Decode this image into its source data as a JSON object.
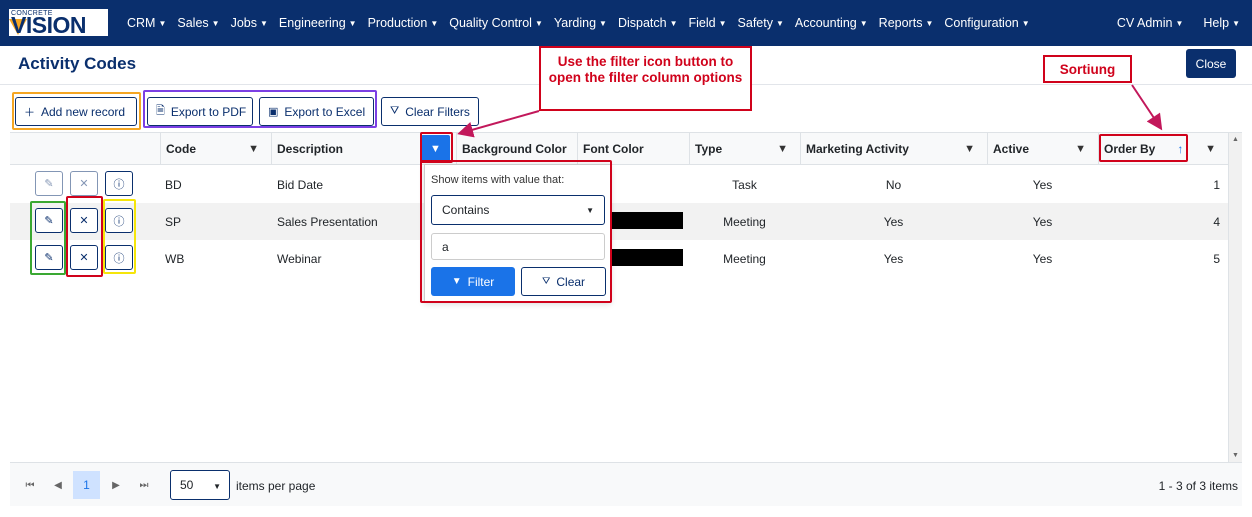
{
  "app": {
    "logo_top": "CONCRETE",
    "logo_main": "VISION",
    "menu": [
      "CRM",
      "Sales",
      "Jobs",
      "Engineering",
      "Production",
      "Quality Control",
      "Yarding",
      "Dispatch",
      "Field",
      "Safety",
      "Accounting",
      "Reports",
      "Configuration"
    ],
    "user_menu": "CV Admin",
    "help_menu": "Help"
  },
  "page": {
    "title": "Activity Codes",
    "close_label": "Close"
  },
  "toolbar": {
    "add_label": "Add new record",
    "export_pdf_label": "Export to PDF",
    "export_excel_label": "Export to Excel",
    "clear_filters_label": "Clear Filters"
  },
  "grid": {
    "columns": [
      "Code",
      "Description",
      "Background Color",
      "Font Color",
      "Type",
      "Marketing Activity",
      "Active",
      "Order By"
    ],
    "rows": [
      {
        "code": "BD",
        "description": "Bid Date",
        "type": "Task",
        "marketing": "No",
        "active": "Yes",
        "order": "1"
      },
      {
        "code": "SP",
        "description": "Sales Presentation",
        "type": "Meeting",
        "marketing": "Yes",
        "active": "Yes",
        "order": "4"
      },
      {
        "code": "WB",
        "description": "Webinar",
        "type": "Meeting",
        "marketing": "Yes",
        "active": "Yes",
        "order": "5"
      }
    ],
    "sort_indicator": "↑"
  },
  "filter_popup": {
    "label": "Show items with value that:",
    "operator": "Contains",
    "value": "a",
    "filter_label": "Filter",
    "clear_label": "Clear"
  },
  "annotations": {
    "filter_note": "Use the filter icon button to open the filter column options",
    "sort_note": "Sortiung"
  },
  "pager": {
    "current_page": "1",
    "page_size": "50",
    "items_per_page_label": "items per page",
    "count_text": "1 - 3 of 3 items"
  },
  "colors": {
    "navbar": "#0a2f6d",
    "accent": "#1a73e8",
    "annotation_red": "#d0021b",
    "outline_orange": "#f5a623",
    "outline_purple": "#7b3fe4",
    "outline_green": "#3aa832",
    "outline_yellow": "#f5e50a"
  }
}
